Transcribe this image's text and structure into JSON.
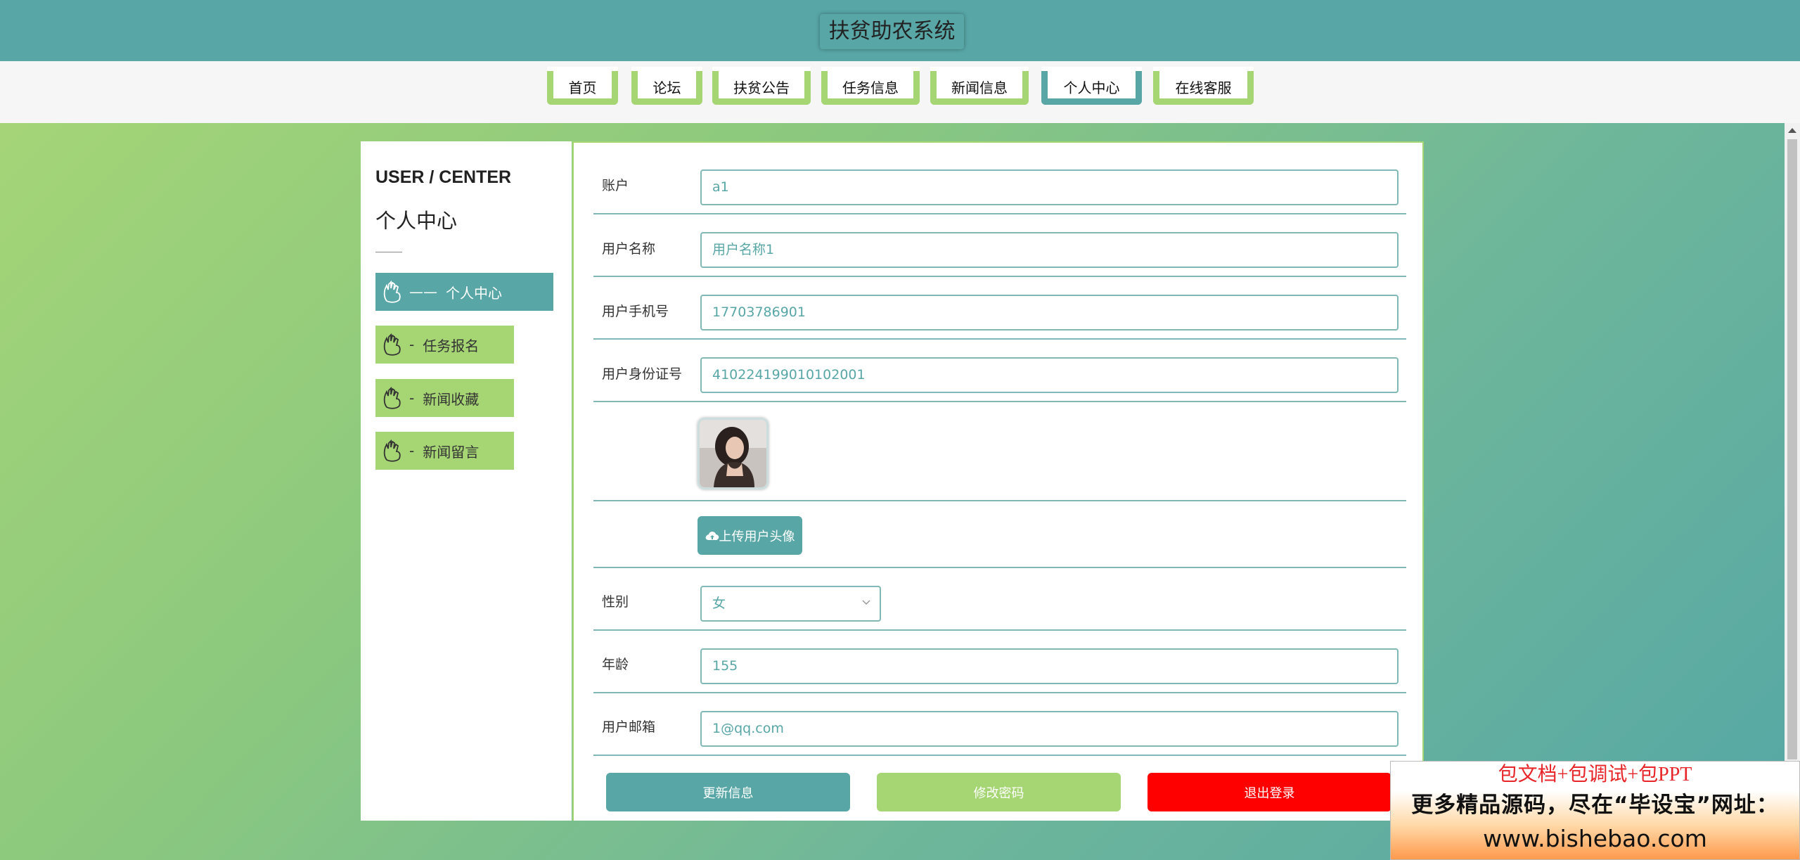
{
  "header": {
    "title": "扶贫助农系统"
  },
  "nav": {
    "items": [
      {
        "label": "首页",
        "active": false
      },
      {
        "label": "论坛",
        "active": false
      },
      {
        "label": "扶贫公告",
        "active": false
      },
      {
        "label": "任务信息",
        "active": false
      },
      {
        "label": "新闻信息",
        "active": false
      },
      {
        "label": "个人中心",
        "active": true
      },
      {
        "label": "在线客服",
        "active": false
      }
    ]
  },
  "sidebar": {
    "heading_en": "USER / CENTER",
    "heading_cn": "个人中心",
    "items": [
      {
        "prefix": "——",
        "label": "个人中心",
        "active": true,
        "icon": "hand-icon"
      },
      {
        "prefix": "-",
        "label": "任务报名",
        "active": false,
        "icon": "hand-icon"
      },
      {
        "prefix": "-",
        "label": "新闻收藏",
        "active": false,
        "icon": "hand-icon"
      },
      {
        "prefix": "-",
        "label": "新闻留言",
        "active": false,
        "icon": "hand-icon"
      }
    ]
  },
  "form": {
    "account": {
      "label": "账户",
      "value": "a1"
    },
    "username": {
      "label": "用户名称",
      "value": "用户名称1"
    },
    "phone": {
      "label": "用户手机号",
      "value": "17703786901"
    },
    "idcard": {
      "label": "用户身份证号",
      "value": "410224199010102001"
    },
    "avatar": {
      "icon": "avatar-photo"
    },
    "upload": {
      "label": "上传用户头像",
      "icon": "cloud-upload-icon"
    },
    "gender": {
      "label": "性别",
      "value": "女",
      "icon": "chevron-down-icon"
    },
    "age": {
      "label": "年龄",
      "value": "155"
    },
    "email": {
      "label": "用户邮箱",
      "value": "1@qq.com"
    }
  },
  "actions": {
    "update": "更新信息",
    "change_password": "修改密码",
    "logout": "退出登录"
  },
  "ad": {
    "line1": "包文档+包调试+包PPT",
    "line2": "更多精品源码，尽在“毕设宝”网址：",
    "line3": "www.bishebao.com"
  },
  "colors": {
    "teal": "#58a6a6",
    "green": "#a6d674",
    "red": "#ff0000"
  }
}
